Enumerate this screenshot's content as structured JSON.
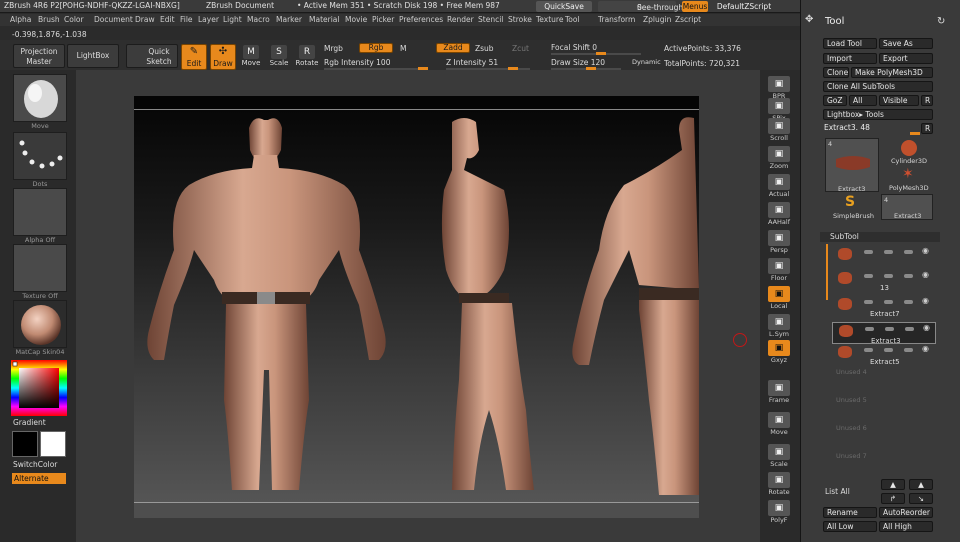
{
  "titlebar": {
    "app": "ZBrush 4R6 P2[POHG-NDHF-QKZZ-LGAI-NBXG]",
    "doc": "ZBrush Document",
    "stats": "• Active Mem 351 • Scratch Disk 198 • Free Mem 987",
    "quicksave": "QuickSave",
    "seethrough": "See-through",
    "seethrough_value": "0",
    "menus": "Menus",
    "script": "DefaultZScript"
  },
  "menubar": [
    "Alpha",
    "Brush",
    "Color",
    "Document",
    "Draw",
    "Edit",
    "File",
    "Layer",
    "Light",
    "Macro",
    "Marker",
    "Material",
    "Movie",
    "Picker",
    "Preferences",
    "Render",
    "Stencil",
    "Stroke",
    "Texture",
    "Tool",
    "Transform",
    "Zplugin",
    "Zscript"
  ],
  "coords": "-0.398,1.876,-1.038",
  "toolbar": {
    "projection_master": "Projection Master",
    "lightbox": "LightBox",
    "quick_sketch": "Quick Sketch",
    "edit": "Edit",
    "draw": "Draw",
    "move": "Move",
    "scale": "Scale",
    "rotate": "Rotate",
    "mrgb": "Mrgb",
    "rgb": "Rgb",
    "m": "M",
    "zadd": "Zadd",
    "zsub": "Zsub",
    "zcut": "Zcut",
    "rgb_intensity_label": "Rgb Intensity",
    "rgb_intensity": "100",
    "z_intensity_label": "Z Intensity",
    "z_intensity": "51",
    "focal_shift_label": "Focal Shift",
    "focal_shift": "0",
    "draw_size_label": "Draw Size",
    "draw_size": "120",
    "dynamic": "Dynamic",
    "active_points_label": "ActivePoints:",
    "active_points": "33,376",
    "total_points_label": "TotalPoints:",
    "total_points": "720,321"
  },
  "leftshelf": {
    "brush": "Move",
    "stroke": "Dots",
    "alpha": "Alpha Off",
    "texture": "Texture Off",
    "material": "MatCap Skin04",
    "gradient": "Gradient",
    "switchcolor": "SwitchColor",
    "alternate": "Alternate"
  },
  "rightshelf": [
    "BPR",
    "SPix",
    "Scroll",
    "Zoom",
    "Actual",
    "AAHalf",
    "Persp",
    "Floor",
    "Local",
    "L.Sym",
    "Gxyz",
    "Frame",
    "Move",
    "Scale",
    "Rotate",
    "PolyF"
  ],
  "toolpanel": {
    "title": "Tool",
    "load_tool": "Load Tool",
    "save_as": "Save As",
    "import": "Import",
    "export": "Export",
    "clone": "Clone",
    "make_polymesh": "Make PolyMesh3D",
    "clone_all": "Clone All SubTools",
    "goz": "GoZ",
    "all": "All",
    "visible": "Visible",
    "r": "R",
    "lightbox_tools": "Lightbox▸ Tools",
    "current_tool": "Extract3. 48",
    "tools": [
      {
        "name": "Extract3",
        "count": "4"
      },
      {
        "name": "Cylinder3D",
        "count": ""
      },
      {
        "name": "PolyMesh3D",
        "count": ""
      },
      {
        "name": "SimpleBrush",
        "count": ""
      },
      {
        "name": "Extract3",
        "count": "4"
      }
    ],
    "subtool_header": "SubTool",
    "subtools": [
      {
        "name": "",
        "count": ""
      },
      {
        "name": "",
        "count": "13"
      },
      {
        "name": "Extract7",
        "count": ""
      },
      {
        "name": "Extract3",
        "count": ""
      },
      {
        "name": "Extract5",
        "count": ""
      }
    ],
    "unused": [
      "Unused 4",
      "Unused 5",
      "Unused 6",
      "Unused 7"
    ],
    "list_all": "List All",
    "rename": "Rename",
    "autoreorder": "AutoReorder",
    "all_low": "All Low",
    "all_high": "All High"
  },
  "colors": {
    "accent": "#e8891c",
    "panel_bg": "#3a3a3a",
    "model_skin": "#c08a72"
  }
}
